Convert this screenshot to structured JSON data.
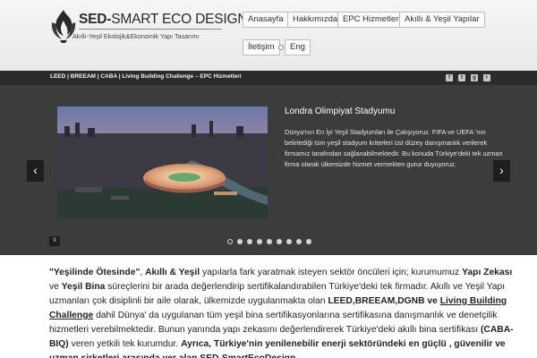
{
  "header": {
    "logo_title_bold": "SED-",
    "logo_title_rest": "SMART ECO DESIGN",
    "logo_subtitle": "Akıllı-Yeşil Ekolojik&Ekonomik Yapı Tasarımı",
    "nav": [
      {
        "label": "Anasayfa"
      },
      {
        "label": "Hakkımızda"
      },
      {
        "label": "EPC Hizmetleri"
      },
      {
        "label": "Akıllı & Yeşil Yapılar"
      },
      {
        "label": "İletişim"
      },
      {
        "label": "Eng"
      }
    ]
  },
  "strip": {
    "links": "LEED | BREEAM | CABA | Living Building Challenge – EPC Hizmetleri",
    "social_icons": [
      "facebook-icon",
      "twitter-icon",
      "googleplus-icon",
      "rss-icon"
    ]
  },
  "slider": {
    "title": "Londra Olimpiyat Stadyumu",
    "description": "Dünya'nın En İyi Yeşil Stadyumları ile Çalışıyoruz. FIFA ve UEFA 'nın belirlediği tüm yeşil stadyum kriterleri üst düzey danışmanlık verilerek firmamız tarafından sağlanabilmektedir. Bu konuda Türkiye'deki tek uzman firma olarak ülkemizde hizmet vermekten gurur duyuyoruz.",
    "prev": "‹",
    "next": "›",
    "pause": "II",
    "dot_count": 9,
    "active_dot": 0
  },
  "content": {
    "p1": "\"Yeşilinde Ötesinde\"",
    "p2": ", ",
    "p3": "Akıllı & Yeşil",
    "p4": " yapılarla fark yaratmak isteyen sektör öncüleri için; kurumumuz ",
    "p5": "Yapı Zekası",
    "p6": " ve ",
    "p7": "Yeşil Bina",
    "p8": " süreçlerini bir arada değerlendirip sertifikalandırabilen Türkiye'deki tek firmadır. Akıllı ve Yeşil Yapı uzmanları çok disiplinli bir aile olarak, ülkemizde uygulanmakta olan ",
    "p9": "LEED",
    "p10": ",",
    "p11": "BREEAM",
    "p12": ",",
    "p13": "DGNB",
    "p14": " ve ",
    "p15": "Living Building Challenge",
    "p16": " dahil Dünya' da uygulanan tüm yeşil bina sertifikasyonlarına sertifikasına danışmanlık ve denetçilik hizmetleri verebilmektedir. Bunun yanında yapı zekasını değerlendirerek Türkiye'deki akıllı bina sertifikası ",
    "p17": "(CABA-BIQ)",
    "p18": " veren yetkili tek kurumdur. ",
    "p19": "Ayrıca, Türkiye'nin yenilenebilir enerji sektöründeki en güçlü , güvenilir ve uzman şirketleri arasında yer alan SED-SmartEcoDesign"
  }
}
